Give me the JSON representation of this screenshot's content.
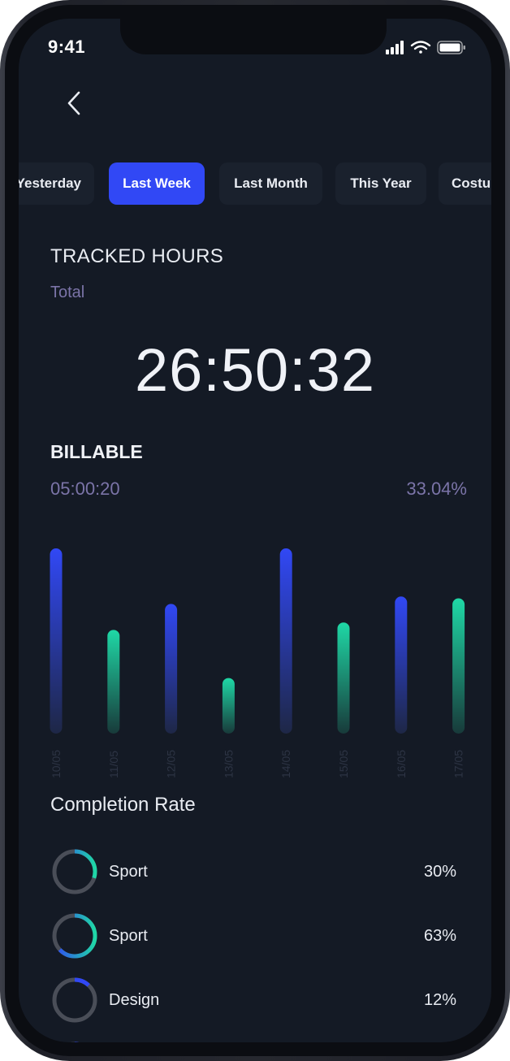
{
  "status_bar": {
    "time": "9:41"
  },
  "tabs": [
    {
      "label": "Yesterday",
      "active": false
    },
    {
      "label": "Last Week",
      "active": true
    },
    {
      "label": "Last Month",
      "active": false
    },
    {
      "label": "This Year",
      "active": false
    },
    {
      "label": "Costum",
      "active": false
    }
  ],
  "tracked": {
    "title": "TRACKED HOURS",
    "total_label": "Total",
    "total_time": "26:50:32"
  },
  "billable": {
    "title": "BILLABLE",
    "time": "05:00:20",
    "percent": "33.04%"
  },
  "chart_data": {
    "type": "bar",
    "categories": [
      "10/05",
      "11/05",
      "12/05",
      "13/05",
      "14/05",
      "15/05",
      "16/05",
      "17/05"
    ],
    "values": [
      1.0,
      0.56,
      0.7,
      0.3,
      1.0,
      0.6,
      0.74,
      0.73
    ],
    "bar_colors": [
      "blue",
      "green",
      "blue",
      "green",
      "blue",
      "green",
      "blue",
      "green"
    ],
    "colors": {
      "blue": "#3148f5",
      "green": "#1fd8a6"
    }
  },
  "completion": {
    "title": "Completion Rate",
    "items": [
      {
        "name": "Sport",
        "percent": "30%",
        "value": 0.3,
        "style": "blue-green"
      },
      {
        "name": "Sport",
        "percent": "63%",
        "value": 0.63,
        "style": "blue-green"
      },
      {
        "name": "Design",
        "percent": "12%",
        "value": 0.12,
        "style": "blue"
      }
    ]
  },
  "colors": {
    "background": "#141a25",
    "accent": "#3148f5",
    "secondary_text": "#7b74a8"
  }
}
